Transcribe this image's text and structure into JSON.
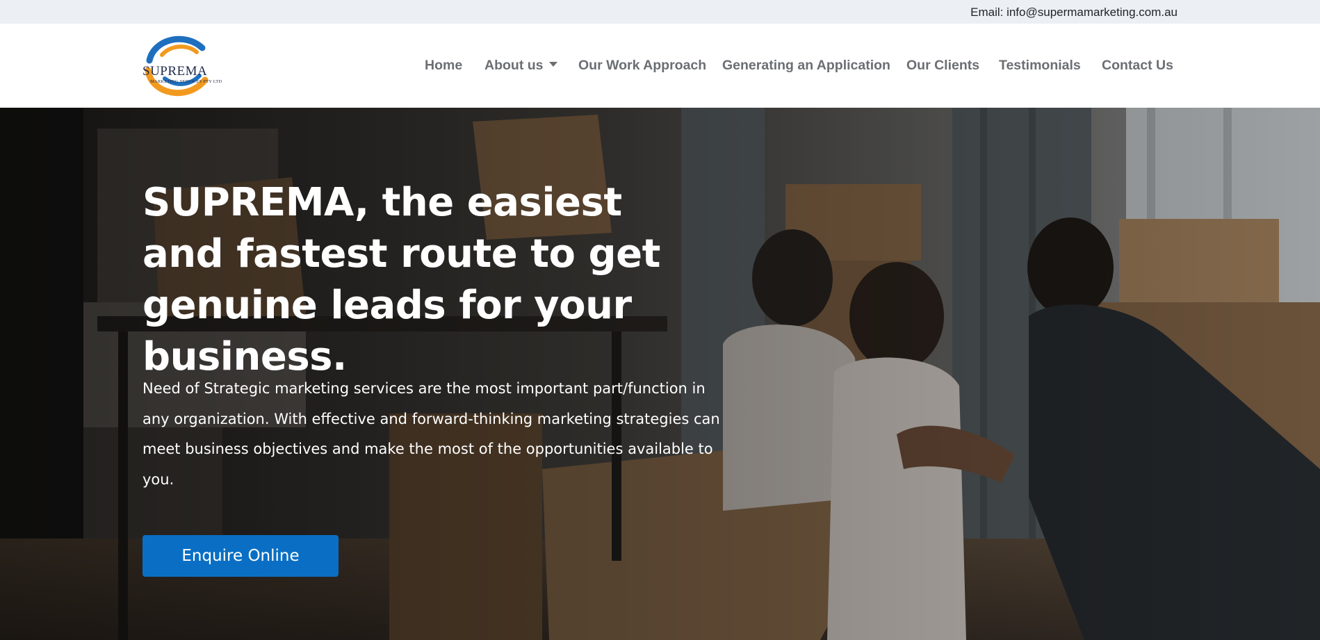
{
  "topbar": {
    "email": "Email: info@supermamarketing.com.au"
  },
  "logo": {
    "name": "SUPREMA",
    "subtitle": "MARKETING SERVICES PTY LTD"
  },
  "nav": {
    "items": [
      {
        "label": "Home"
      },
      {
        "label": "About us"
      },
      {
        "label": "Our Work Approach"
      },
      {
        "label": "Generating an Application"
      },
      {
        "label": "Our Clients"
      },
      {
        "label": "Testimonials"
      },
      {
        "label": "Contact Us"
      }
    ]
  },
  "hero": {
    "title": "SUPREMA, the easiest and fastest route to get genuine leads for your business.",
    "body": "Need of Strategic marketing services are the most important part/function in any organization. With effective and forward-thinking marketing strategies can meet business objectives and make the most of the opportunities available to you.",
    "cta_label": "Enquire Online"
  },
  "colors": {
    "topbar_bg": "#eceff3",
    "cta_bg": "#0a6fc4",
    "nav_text": "#6b6e72",
    "logo_blue": "#1f6fbf",
    "logo_orange": "#f29a1f"
  }
}
